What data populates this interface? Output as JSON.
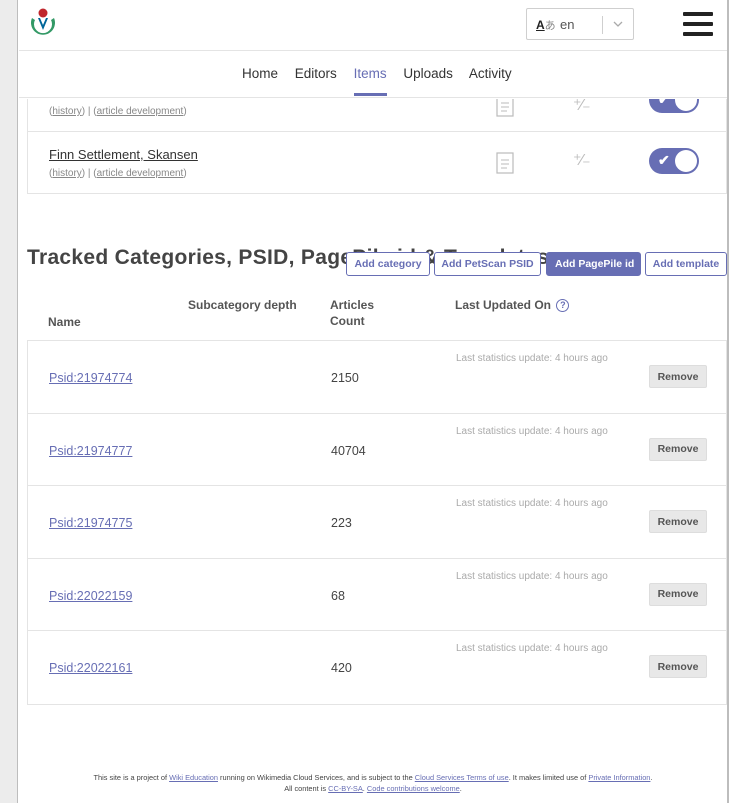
{
  "header": {
    "language": "en",
    "colors": {
      "accent": "#676eb4"
    }
  },
  "nav": {
    "items": [
      "Home",
      "Editors",
      "Items",
      "Uploads",
      "Activity"
    ],
    "active": "Items"
  },
  "articles": [
    {
      "title": "",
      "history_link": "history",
      "sep": "|",
      "dev_link": "article development"
    },
    {
      "title": "Finn Settlement, Skansen",
      "history_link": "history",
      "sep": "|",
      "dev_link": "article development"
    }
  ],
  "tracked": {
    "title": "Tracked Categories, PSID, PagePile id & Templates",
    "buttons": {
      "add_category": "Add category",
      "add_psid": "Add PetScan PSID",
      "add_pagepile": "Add PagePile id",
      "add_template": "Add template"
    },
    "columns": {
      "name": "Name",
      "subcategory_depth": "Subcategory depth",
      "articles_count": "Articles Count",
      "last_updated": "Last Updated On"
    },
    "rows": [
      {
        "name": "Psid:21974774",
        "count": "2150",
        "updated": "Last statistics update: 4 hours ago",
        "remove": "Remove"
      },
      {
        "name": "Psid:21974777",
        "count": "40704",
        "updated": "Last statistics update: 4 hours ago",
        "remove": "Remove"
      },
      {
        "name": "Psid:21974775",
        "count": "223",
        "updated": "Last statistics update: 4 hours ago",
        "remove": "Remove"
      },
      {
        "name": "Psid:22022159",
        "count": "68",
        "updated": "Last statistics update: 4 hours ago",
        "remove": "Remove"
      },
      {
        "name": "Psid:22022161",
        "count": "420",
        "updated": "Last statistics update: 4 hours ago",
        "remove": "Remove"
      }
    ]
  },
  "footer": {
    "t1": "This site is a project of ",
    "wiki_education": "Wiki Education",
    "t2": " running on Wikimedia Cloud Services, and is subject to the ",
    "cloud_terms": "Cloud Services Terms of use",
    "t3": ". It makes limited use of ",
    "private_info": "Private Information",
    "t4": ".",
    "t5": "All content is ",
    "license": "CC-BY-SA",
    "t6": ". ",
    "contrib": "Code contributions welcome",
    "t7": "."
  }
}
